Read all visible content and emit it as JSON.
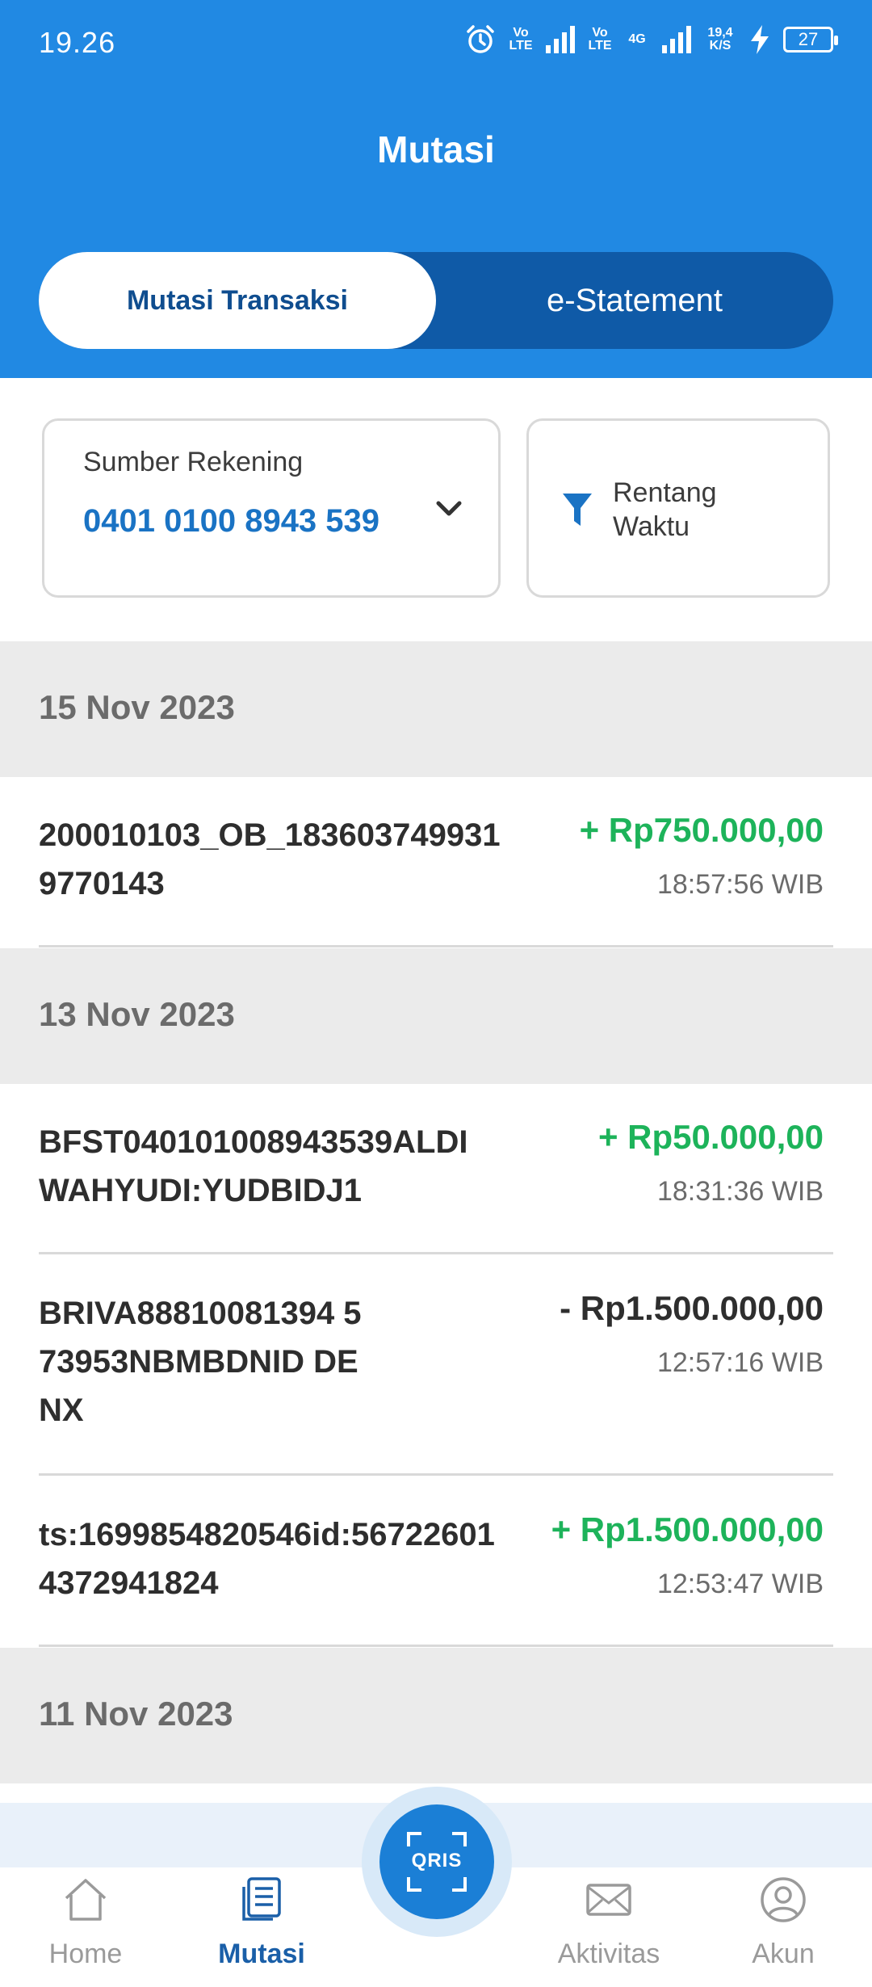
{
  "status_bar": {
    "time": "19.26",
    "network1": "Vo LTE",
    "network2": "Vo LTE",
    "network3": "4G",
    "speed": "19,4 K/S",
    "battery": "27"
  },
  "header": {
    "title": "Mutasi"
  },
  "tabs": [
    {
      "label": "Mutasi Transaksi",
      "active": true
    },
    {
      "label": "e-Statement",
      "active": false
    }
  ],
  "filters": {
    "source_label": "Sumber Rekening",
    "source_value": "0401 0100 8943 539",
    "range_label": "Rentang Waktu"
  },
  "groups": [
    {
      "date": "15 Nov 2023",
      "transactions": [
        {
          "desc": "200010103_OB_1836037499319770143",
          "amount": "+ Rp750.000,00",
          "time": "18:57:56 WIB",
          "type": "credit"
        }
      ]
    },
    {
      "date": "13 Nov 2023",
      "transactions": [
        {
          "desc": "BFST040101008943539ALDI WAHYUDI:YUDBIDJ1",
          "amount": "+ Rp50.000,00",
          "time": "18:31:36 WIB",
          "type": "credit"
        },
        {
          "desc": "BRIVA88810081394 573953NBMBDNID DENX",
          "amount": "- Rp1.500.000,00",
          "time": "12:57:16 WIB",
          "type": "debit"
        },
        {
          "desc": "ts:1699854820546id:567226014372941824",
          "amount": "+ Rp1.500.000,00",
          "time": "12:53:47 WIB",
          "type": "credit"
        }
      ]
    },
    {
      "date": "11 Nov 2023",
      "transactions": []
    }
  ],
  "bottom_nav": {
    "items": [
      {
        "label": "Home",
        "icon": "home-icon",
        "active": false
      },
      {
        "label": "Mutasi",
        "icon": "document-icon",
        "active": true
      },
      {
        "label": "Aktivitas",
        "icon": "mail-icon",
        "active": false
      },
      {
        "label": "Akun",
        "icon": "user-icon",
        "active": false
      }
    ],
    "qris_label": "QRIS"
  },
  "colors": {
    "header_blue": "#2189e3",
    "tab_dark": "#0f5aa7",
    "credit_green": "#1db35a",
    "account_blue": "#1a73c4"
  }
}
